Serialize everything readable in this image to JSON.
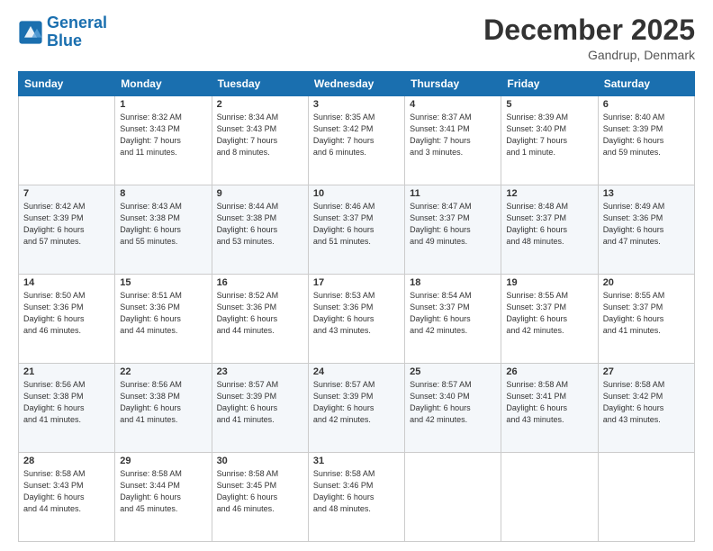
{
  "header": {
    "logo_text_general": "General",
    "logo_text_blue": "Blue",
    "month_title": "December 2025",
    "location": "Gandrup, Denmark"
  },
  "days_of_week": [
    "Sunday",
    "Monday",
    "Tuesday",
    "Wednesday",
    "Thursday",
    "Friday",
    "Saturday"
  ],
  "weeks": [
    [
      {
        "day": "",
        "info": ""
      },
      {
        "day": "1",
        "info": "Sunrise: 8:32 AM\nSunset: 3:43 PM\nDaylight: 7 hours\nand 11 minutes."
      },
      {
        "day": "2",
        "info": "Sunrise: 8:34 AM\nSunset: 3:43 PM\nDaylight: 7 hours\nand 8 minutes."
      },
      {
        "day": "3",
        "info": "Sunrise: 8:35 AM\nSunset: 3:42 PM\nDaylight: 7 hours\nand 6 minutes."
      },
      {
        "day": "4",
        "info": "Sunrise: 8:37 AM\nSunset: 3:41 PM\nDaylight: 7 hours\nand 3 minutes."
      },
      {
        "day": "5",
        "info": "Sunrise: 8:39 AM\nSunset: 3:40 PM\nDaylight: 7 hours\nand 1 minute."
      },
      {
        "day": "6",
        "info": "Sunrise: 8:40 AM\nSunset: 3:39 PM\nDaylight: 6 hours\nand 59 minutes."
      }
    ],
    [
      {
        "day": "7",
        "info": "Sunrise: 8:42 AM\nSunset: 3:39 PM\nDaylight: 6 hours\nand 57 minutes."
      },
      {
        "day": "8",
        "info": "Sunrise: 8:43 AM\nSunset: 3:38 PM\nDaylight: 6 hours\nand 55 minutes."
      },
      {
        "day": "9",
        "info": "Sunrise: 8:44 AM\nSunset: 3:38 PM\nDaylight: 6 hours\nand 53 minutes."
      },
      {
        "day": "10",
        "info": "Sunrise: 8:46 AM\nSunset: 3:37 PM\nDaylight: 6 hours\nand 51 minutes."
      },
      {
        "day": "11",
        "info": "Sunrise: 8:47 AM\nSunset: 3:37 PM\nDaylight: 6 hours\nand 49 minutes."
      },
      {
        "day": "12",
        "info": "Sunrise: 8:48 AM\nSunset: 3:37 PM\nDaylight: 6 hours\nand 48 minutes."
      },
      {
        "day": "13",
        "info": "Sunrise: 8:49 AM\nSunset: 3:36 PM\nDaylight: 6 hours\nand 47 minutes."
      }
    ],
    [
      {
        "day": "14",
        "info": "Sunrise: 8:50 AM\nSunset: 3:36 PM\nDaylight: 6 hours\nand 46 minutes."
      },
      {
        "day": "15",
        "info": "Sunrise: 8:51 AM\nSunset: 3:36 PM\nDaylight: 6 hours\nand 44 minutes."
      },
      {
        "day": "16",
        "info": "Sunrise: 8:52 AM\nSunset: 3:36 PM\nDaylight: 6 hours\nand 44 minutes."
      },
      {
        "day": "17",
        "info": "Sunrise: 8:53 AM\nSunset: 3:36 PM\nDaylight: 6 hours\nand 43 minutes."
      },
      {
        "day": "18",
        "info": "Sunrise: 8:54 AM\nSunset: 3:37 PM\nDaylight: 6 hours\nand 42 minutes."
      },
      {
        "day": "19",
        "info": "Sunrise: 8:55 AM\nSunset: 3:37 PM\nDaylight: 6 hours\nand 42 minutes."
      },
      {
        "day": "20",
        "info": "Sunrise: 8:55 AM\nSunset: 3:37 PM\nDaylight: 6 hours\nand 41 minutes."
      }
    ],
    [
      {
        "day": "21",
        "info": "Sunrise: 8:56 AM\nSunset: 3:38 PM\nDaylight: 6 hours\nand 41 minutes."
      },
      {
        "day": "22",
        "info": "Sunrise: 8:56 AM\nSunset: 3:38 PM\nDaylight: 6 hours\nand 41 minutes."
      },
      {
        "day": "23",
        "info": "Sunrise: 8:57 AM\nSunset: 3:39 PM\nDaylight: 6 hours\nand 41 minutes."
      },
      {
        "day": "24",
        "info": "Sunrise: 8:57 AM\nSunset: 3:39 PM\nDaylight: 6 hours\nand 42 minutes."
      },
      {
        "day": "25",
        "info": "Sunrise: 8:57 AM\nSunset: 3:40 PM\nDaylight: 6 hours\nand 42 minutes."
      },
      {
        "day": "26",
        "info": "Sunrise: 8:58 AM\nSunset: 3:41 PM\nDaylight: 6 hours\nand 43 minutes."
      },
      {
        "day": "27",
        "info": "Sunrise: 8:58 AM\nSunset: 3:42 PM\nDaylight: 6 hours\nand 43 minutes."
      }
    ],
    [
      {
        "day": "28",
        "info": "Sunrise: 8:58 AM\nSunset: 3:43 PM\nDaylight: 6 hours\nand 44 minutes."
      },
      {
        "day": "29",
        "info": "Sunrise: 8:58 AM\nSunset: 3:44 PM\nDaylight: 6 hours\nand 45 minutes."
      },
      {
        "day": "30",
        "info": "Sunrise: 8:58 AM\nSunset: 3:45 PM\nDaylight: 6 hours\nand 46 minutes."
      },
      {
        "day": "31",
        "info": "Sunrise: 8:58 AM\nSunset: 3:46 PM\nDaylight: 6 hours\nand 48 minutes."
      },
      {
        "day": "",
        "info": ""
      },
      {
        "day": "",
        "info": ""
      },
      {
        "day": "",
        "info": ""
      }
    ]
  ]
}
